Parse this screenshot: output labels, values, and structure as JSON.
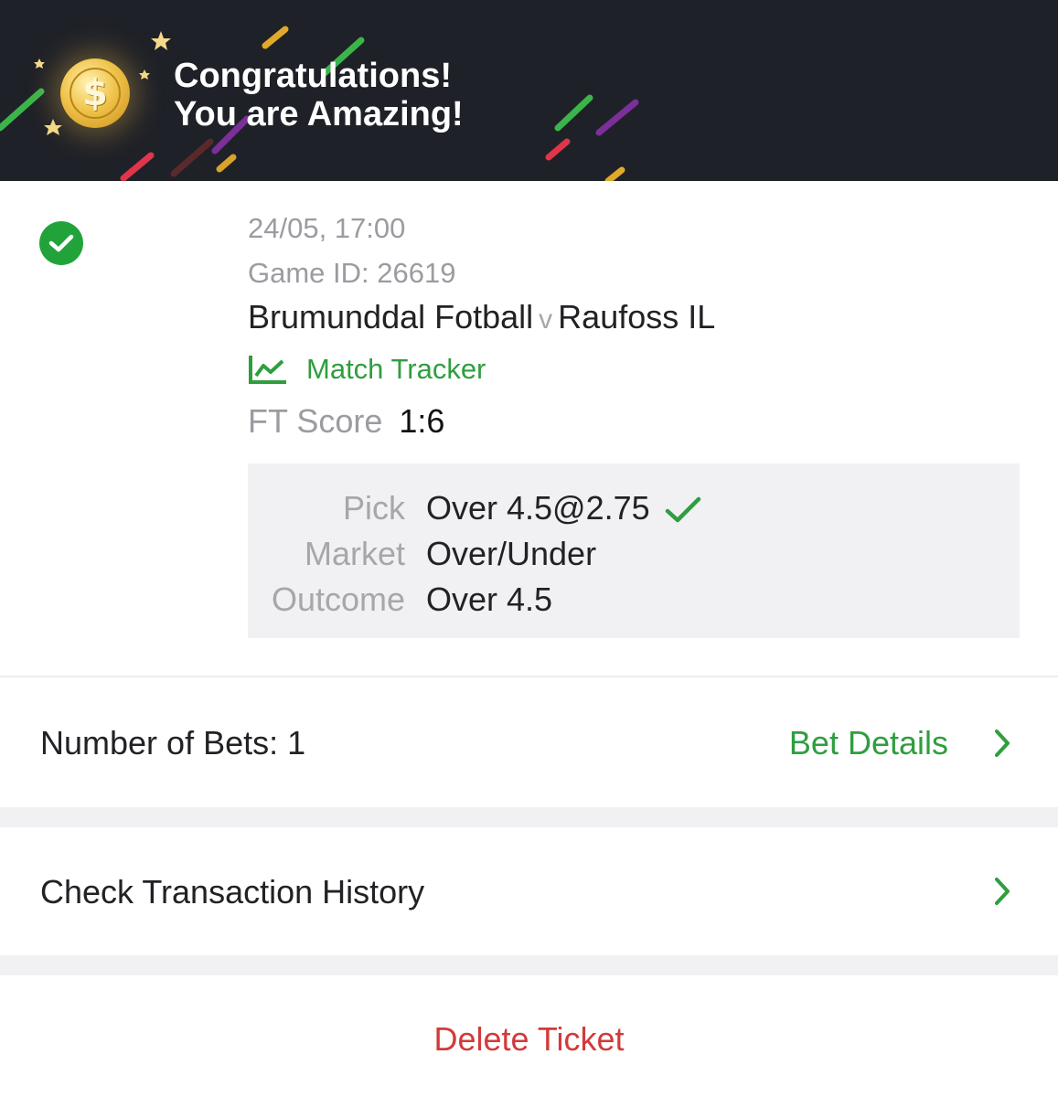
{
  "banner": {
    "line1": "Congratulations!",
    "line2": "You are Amazing!",
    "coin_symbol": "$",
    "icon": "coin-icon"
  },
  "match": {
    "status_icon": "check-circle-icon",
    "datetime": "24/05, 17:00",
    "game_id": "Game ID: 26619",
    "home": "Brumunddal Fotball",
    "vs": "v",
    "away": "Raufoss IL",
    "tracker_label": "Match Tracker",
    "ft_label": "FT Score",
    "ft_value": "1:6"
  },
  "pick": {
    "pick_label": "Pick",
    "pick_value": "Over 4.5@2.75",
    "market_label": "Market",
    "market_value": "Over/Under",
    "outcome_label": "Outcome",
    "outcome_value": "Over 4.5"
  },
  "summary": {
    "number_of_bets": "Number of Bets: 1",
    "bet_details": "Bet Details"
  },
  "history": {
    "label": "Check Transaction History"
  },
  "actions": {
    "delete": "Delete Ticket"
  },
  "colors": {
    "accent_green": "#2e9e3e",
    "danger_red": "#d23a3a",
    "banner_bg": "#1f2128"
  }
}
